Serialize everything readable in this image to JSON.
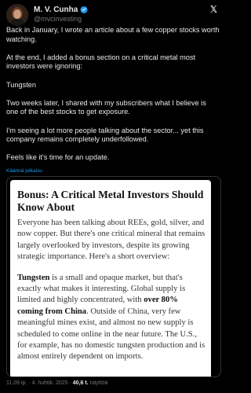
{
  "author": {
    "display_name": "M. V. Cunha",
    "handle": "@mvcinvesting"
  },
  "tweet": {
    "paragraphs": [
      "Back in January, I wrote an article about a few copper stocks worth watching.",
      "At the end, I added a bonus section on a critical metal most investors were ignoring:",
      "Tungsten",
      "Two weeks later, I shared with my subscribers what I believe is one of the best stocks to get exposure.",
      "I'm seeing a lot more people talking about the sector... yet this company remains completely underfollowed.",
      "Feels like it's time for an update."
    ],
    "translate_label": "Käännä julkaisu"
  },
  "article": {
    "title": "Bonus: A Critical Metal Investors Should Know About",
    "p1": "Everyone has been talking about REEs, gold, silver, and now copper. But there's one critical mineral that remains largely overlooked by investors, despite its growing strategic importance. Here's a short overview:",
    "p2_bold_lead": "Tungsten",
    "p2_a": " is a small and opaque market, but that's exactly what makes it interesting. Global supply is limited and highly concentrated, with ",
    "p2_bold_mid": "over 80% coming from China",
    "p2_b": ". Outside of China, very few meaningful mines exist, and almost no new supply is scheduled to come online in the near future. The U.S., for example, has no domestic tungsten production and is almost entirely dependent on imports."
  },
  "meta": {
    "time": "11.09 ip.",
    "separator": "·",
    "date": "4. huhtik. 2025",
    "views_count": "40,6 t.",
    "views_label": "näyttöä"
  },
  "colors": {
    "background": "#000000",
    "text": "#e7e9ea",
    "muted": "#71767b",
    "accent": "#1d9bf0",
    "card_border": "#2f3336"
  },
  "icons": {
    "verified": "verified-badge-icon",
    "logo": "x-logo-icon"
  }
}
